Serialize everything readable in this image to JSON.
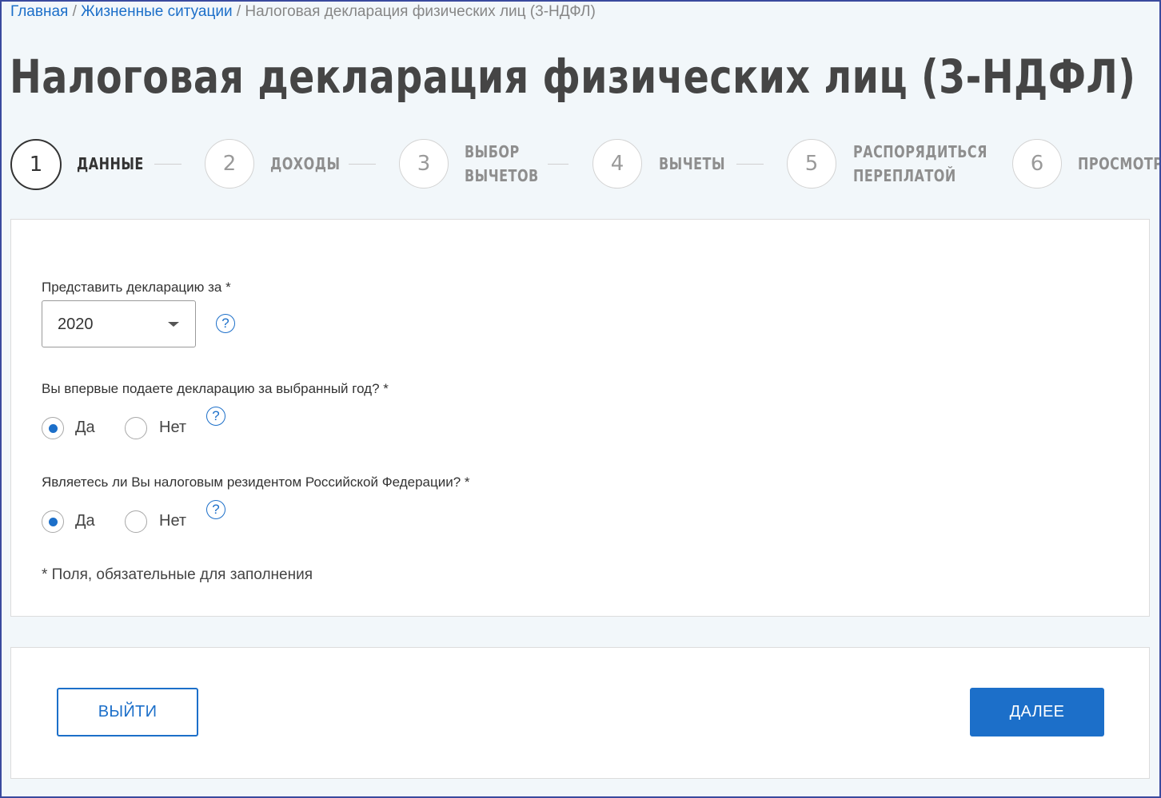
{
  "breadcrumb": {
    "home": "Главная",
    "separator": "/",
    "situations": "Жизненные ситуации",
    "current": "Налоговая декларация физических лиц (3-НДФЛ)"
  },
  "page_title": "Налоговая декларация физических лиц (3-НДФЛ)",
  "steps": [
    {
      "number": "1",
      "label": "ДАННЫЕ",
      "active": true
    },
    {
      "number": "2",
      "label": "ДОХОДЫ",
      "active": false
    },
    {
      "number": "3",
      "label_line1": "ВЫБОР",
      "label_line2": "ВЫЧЕТОВ",
      "active": false
    },
    {
      "number": "4",
      "label": "ВЫЧЕТЫ",
      "active": false
    },
    {
      "number": "5",
      "label_line1": "РАСПОРЯДИТЬСЯ",
      "label_line2": "ПЕРЕПЛАТОЙ",
      "active": false
    },
    {
      "number": "6",
      "label": "ПРОСМОТР",
      "active": false
    }
  ],
  "form": {
    "year_label": "Представить декларацию за *",
    "year_value": "2020",
    "first_time_label": "Вы впервые подаете декларацию за выбранный год? *",
    "first_time": {
      "yes": "Да",
      "no": "Нет",
      "selected": "yes"
    },
    "resident_label": "Являетесь ли Вы налоговым резидентом Российской Федерации? *",
    "resident": {
      "yes": "Да",
      "no": "Нет",
      "selected": "yes"
    },
    "help_symbol": "?",
    "required_note": "* Поля, обязательные для заполнения"
  },
  "buttons": {
    "exit": "ВЫЙТИ",
    "next": "ДАЛЕЕ"
  },
  "colors": {
    "accent": "#1c6fc9",
    "background": "#f2f7fa",
    "frame": "#3a4a9e"
  }
}
